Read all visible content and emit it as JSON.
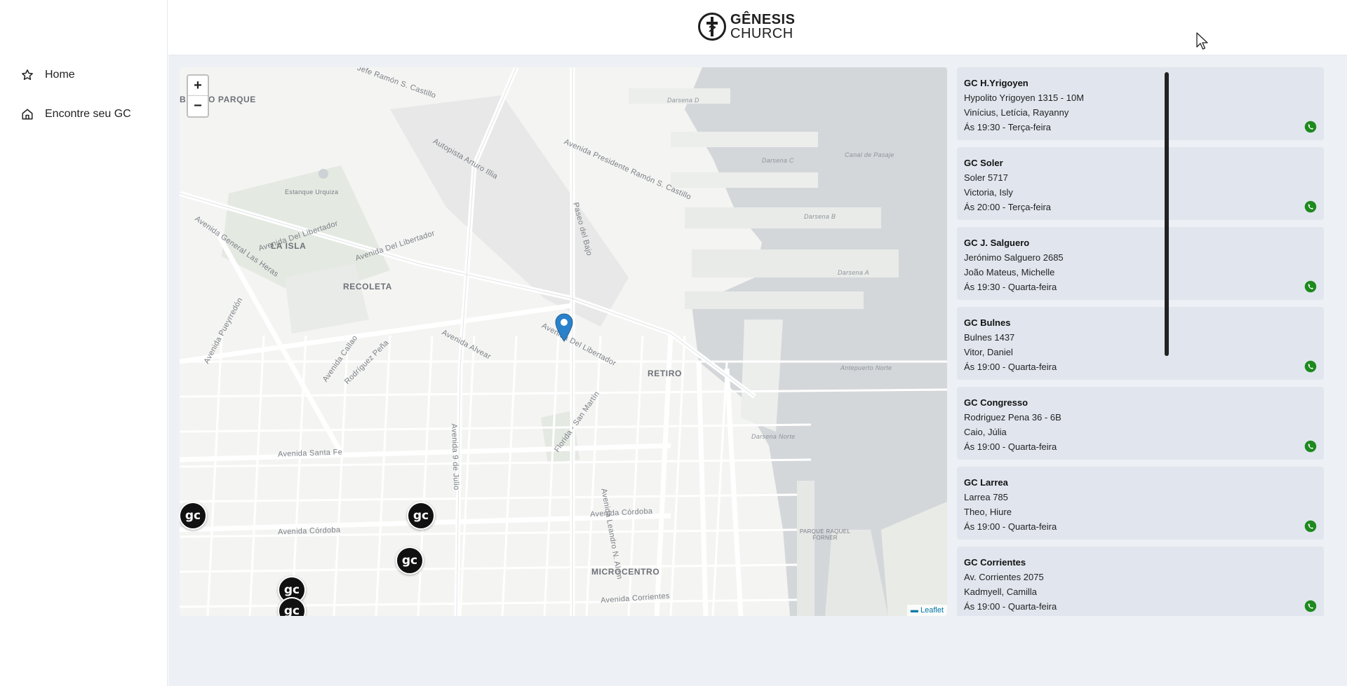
{
  "sidebar": {
    "items": [
      {
        "label": "Home",
        "icon": "star-icon"
      },
      {
        "label": "Encontre seu GC",
        "icon": "home-icon"
      }
    ]
  },
  "header": {
    "logo_line1": "GÊNESIS",
    "logo_line2": "CHURCH"
  },
  "map": {
    "zoom_in": "+",
    "zoom_out": "−",
    "attribution": "Leaflet",
    "marker_label": "gc",
    "labels": {
      "barrio_parque": "BARRIO PARQUE",
      "la_isla": "LA ISLA",
      "recoleta": "RECOLETA",
      "retiro": "RETIRO",
      "microcentro": "MICROCENTRO",
      "estanque": "Estanque Urquiza",
      "darsena_d": "Darsena D",
      "darsena_c": "Darsena C",
      "darsena_b": "Darsena B",
      "darsena_a": "Darsena A",
      "darsena_norte": "Darsena Norte",
      "canal": "Canal de Pasaje",
      "antepuerto": "Antepuerto Norte",
      "parque_raquel": "PARQUE RAQUEL FORNER",
      "av_libertador_1": "Avenida Del Libertador",
      "av_libertador_2": "Avenida Del Libertador",
      "av_libertador_3": "Avenida Del Libertador",
      "av_santa_fe": "Avenida Santa Fe",
      "av_cordoba": "Avenida Córdoba",
      "av_cordoba_2": "Avenida Córdoba",
      "av_corrientes": "Avenida Corrientes",
      "av_9_julio": "Avenida 9 de Julio",
      "av_pueyrredon": "Avenida Pueyrredón",
      "av_callao": "Avenida Callao",
      "av_alvear": "Avenida Alvear",
      "autopista_illia": "Autopista Arturo Illia",
      "av_ramon_castillo": "Avenida Presidente Ramón S. Castillo",
      "paseo_bajo": "Paseo del Bajo",
      "rodriguez_pena": "Rodríguez Peña",
      "san_martin": "Florida - San Martín",
      "leandro_alem": "Avenida Leandro N. Alem",
      "gral_las_heras": "Avenida General Las Heras",
      "jefe_ramon": "Jefe Ramón S. Castillo"
    }
  },
  "groups": [
    {
      "name": "GC H.Yrigoyen",
      "address": "Hypolito Yrigoyen 1315 - 10M",
      "leaders": "Vinícius, Letícia, Rayanny",
      "time": "Ás 19:30 - Terça-feira"
    },
    {
      "name": "GC Soler",
      "address": "Soler 5717",
      "leaders": "Victoria, Isly",
      "time": "Ás 20:00 - Terça-feira"
    },
    {
      "name": "GC J. Salguero",
      "address": "Jerónimo Salguero 2685",
      "leaders": "João Mateus, Michelle",
      "time": "Ás 19:30 - Quarta-feira"
    },
    {
      "name": "GC Bulnes",
      "address": "Bulnes 1437",
      "leaders": "Vitor, Daniel",
      "time": "Ás 19:00 - Quarta-feira"
    },
    {
      "name": "GC Congresso",
      "address": "Rodriguez Pena 36 - 6B",
      "leaders": "Caio, Júlia",
      "time": "Ás 19:00 - Quarta-feira"
    },
    {
      "name": "GC Larrea",
      "address": "Larrea 785",
      "leaders": "Theo, Hiure",
      "time": "Ás 19:00 - Quarta-feira"
    },
    {
      "name": "GC Corrientes",
      "address": "Av. Corrientes 2075",
      "leaders": "Kadmyell, Camilla",
      "time": "Ás 19:00 - Quarta-feira"
    }
  ],
  "colors": {
    "accent_whatsapp": "#1e8a1e",
    "card_bg": "#e1e6ee",
    "page_bg": "#edf0f4",
    "pin": "#2a81cb"
  }
}
